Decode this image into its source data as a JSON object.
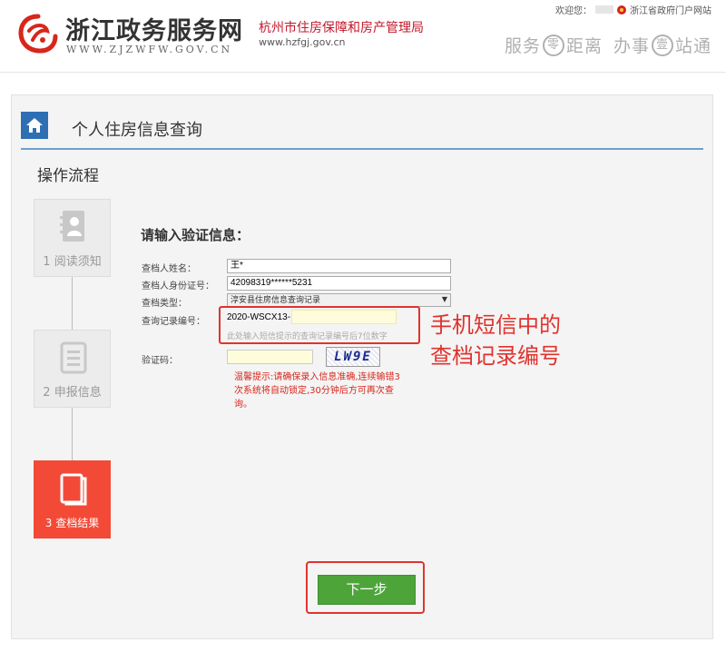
{
  "header": {
    "site_name": "浙江政务服务网",
    "site_url": "WWW.ZJZWFW.GOV.CN",
    "agency_name": "杭州市住房保障和房产管理局",
    "agency_url": "www.hzfgj.gov.cn",
    "welcome": "欢迎您：",
    "portal_link": "浙江省政府门户网站",
    "slogan": {
      "w1": "服务",
      "c1": "零",
      "w2": "距离",
      "w3": "办事",
      "c2": "壹",
      "w4": "站通"
    }
  },
  "page_title": "个人住房信息查询",
  "flow": {
    "title": "操作流程",
    "steps": [
      {
        "label": "1 阅读须知"
      },
      {
        "label": "2 申报信息"
      },
      {
        "label": "3 查档结果"
      }
    ]
  },
  "form": {
    "heading": "请输入验证信息：",
    "name_label": "查档人姓名：",
    "name_value": "王*",
    "id_label": "查档人身份证号：",
    "id_value": "42098319******5231",
    "type_label": "查档类型：",
    "type_value": "淳安县住房信息查询记录",
    "record_label": "查询记录编号：",
    "record_prefix": "2020-WSCX13-",
    "record_hint": "此处输入短信提示的查询记录编号后7位数字",
    "captcha_label": "验证码：",
    "captcha_text": "LW9E",
    "warning": "温馨提示:请确保录入信息准确,连续输错3次系统将自动锁定,30分钟后方可再次查询。"
  },
  "annotation": {
    "line1": "手机短信中的",
    "line2": "查档记录编号"
  },
  "next_button": "下一步",
  "colors": {
    "accent_blue": "#2e6fb3",
    "active_step": "#f24a37",
    "button_green": "#4da53a",
    "annotation_red": "#e0332e"
  }
}
